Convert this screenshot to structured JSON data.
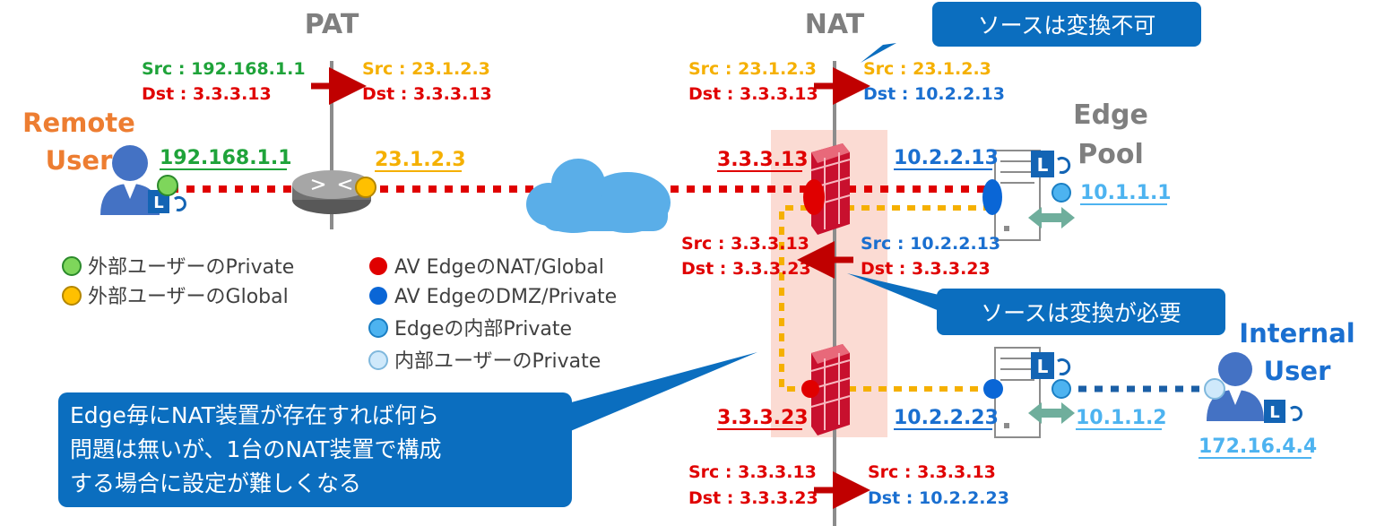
{
  "colors": {
    "green": "#1fa33a",
    "orange": "#f5b000",
    "red": "#e00000",
    "blue": "#1a6fd0",
    "lightblue": "#4db3f0",
    "callout": "#0b6ebf",
    "user_orange": "#ed7d31",
    "header_gray": "#7f7f7f"
  },
  "headers": {
    "pat": "PAT",
    "nat": "NAT"
  },
  "bubbles": {
    "top": "ソースは変換不可",
    "mid": "ソースは変換が必要",
    "bottom": [
      "Edge毎にNAT装置が存在すれば何ら",
      "問題は無いが、1台のNAT装置で構成",
      "する場合に設定が難しくなる"
    ]
  },
  "remote_user": {
    "line1": "Remote",
    "line2": "User",
    "ip": "192.168.1.1"
  },
  "pat_router": {
    "ip": "23.1.2.3"
  },
  "edge_pool": {
    "line1": "Edge",
    "line2": "Pool"
  },
  "internal_user": {
    "line1": "Internal",
    "line2": "User",
    "ip": "172.16.4.4"
  },
  "ips": {
    "fw_top": "3.3.3.13",
    "fw_bottom": "3.3.3.23",
    "dmz_top": "10.2.2.13",
    "dmz_bottom": "10.2.2.23",
    "int_top": "10.1.1.1",
    "int_bottom": "10.1.1.2"
  },
  "packets": {
    "p1": {
      "src": "Src : 192.168.1.1",
      "dst": "Dst : 3.3.3.13"
    },
    "p2": {
      "src": "Src : 23.1.2.3",
      "dst": "Dst : 3.3.3.13"
    },
    "p3": {
      "src": "Src : 23.1.2.3",
      "dst": "Dst : 3.3.3.13"
    },
    "p4": {
      "src": "Src : 23.1.2.3",
      "dst": "Dst : 10.2.2.13"
    },
    "p5": {
      "src": "Src : 3.3.3.13",
      "dst": "Dst : 3.3.3.23"
    },
    "p6": {
      "src": "Src : 10.2.2.13",
      "dst": "Dst : 3.3.3.23"
    },
    "p7": {
      "src": "Src : 3.3.3.13",
      "dst": "Dst : 3.3.3.23"
    },
    "p8": {
      "src": "Src : 3.3.3.13",
      "dst": "Dst : 10.2.2.23"
    }
  },
  "legend": [
    "外部ユーザーのPrivate",
    "外部ユーザーのGlobal",
    "AV EdgeのNAT/Global",
    "AV EdgeのDMZ/Private",
    "Edgeの内部Private",
    "内部ユーザーのPrivate"
  ]
}
